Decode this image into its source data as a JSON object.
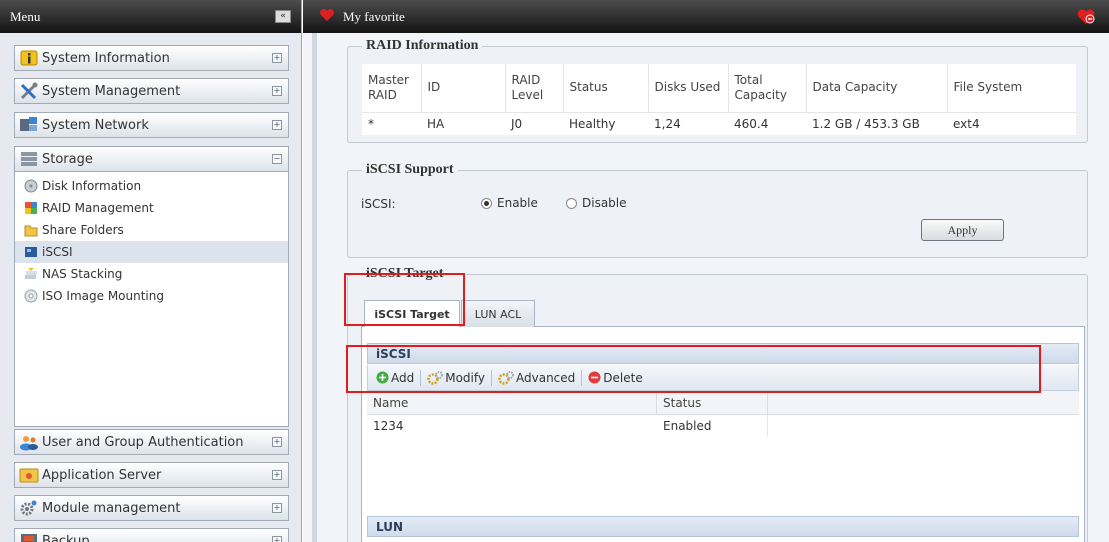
{
  "sidebar": {
    "title": "Menu",
    "collapse_label": "«",
    "categories": [
      {
        "label": "System Information",
        "icon": "info-icon"
      },
      {
        "label": "System Management",
        "icon": "tools-icon"
      },
      {
        "label": "System Network",
        "icon": "network-icon"
      },
      {
        "label": "Storage",
        "icon": "storage-icon"
      },
      {
        "label": "User and Group Authentication",
        "icon": "users-icon"
      },
      {
        "label": "Application Server",
        "icon": "app-server-icon"
      },
      {
        "label": "Module management",
        "icon": "gear-icon"
      },
      {
        "label": "Backup",
        "icon": "backup-icon"
      }
    ],
    "expand_symbol": "+",
    "collapse_symbol": "−",
    "storage_items": [
      {
        "label": "Disk Information",
        "icon": "disk-icon"
      },
      {
        "label": "RAID Management",
        "icon": "raid-icon"
      },
      {
        "label": "Share Folders",
        "icon": "folder-icon"
      },
      {
        "label": "iSCSI",
        "icon": "iscsi-icon"
      },
      {
        "label": "NAS Stacking",
        "icon": "stacking-icon"
      },
      {
        "label": "ISO Image Mounting",
        "icon": "iso-icon"
      }
    ]
  },
  "topbar": {
    "title": "My favorite"
  },
  "raid": {
    "legend": "RAID Information",
    "headers": [
      "Master RAID",
      "ID",
      "RAID Level",
      "Status",
      "Disks Used",
      "Total Capacity",
      "Data Capacity",
      "File System"
    ],
    "row": [
      "*",
      "HA",
      "J0",
      "Healthy",
      "1,24",
      "460.4",
      "1.2 GB / 453.3 GB",
      "ext4"
    ]
  },
  "iscsi_support": {
    "legend": "iSCSI Support",
    "field_label": "iSCSI:",
    "enable_label": "Enable",
    "disable_label": "Disable",
    "selected": "Enable",
    "apply_label": "Apply"
  },
  "iscsi_target": {
    "legend": "iSCSI Target",
    "tabs": [
      "iSCSI Target",
      "LUN ACL"
    ],
    "active_tab": "iSCSI Target",
    "grid_title": "iSCSI",
    "toolbar": {
      "add": "Add",
      "modify": "Modify",
      "advanced": "Advanced",
      "delete": "Delete"
    },
    "columns": [
      "Name",
      "Status"
    ],
    "rows": [
      {
        "name": "1234",
        "status": "Enabled"
      }
    ],
    "lun_title": "LUN"
  },
  "colors": {
    "highlight": "#e01c1c",
    "header_bg": "#141414",
    "panel_bg": "#eef1f6"
  }
}
